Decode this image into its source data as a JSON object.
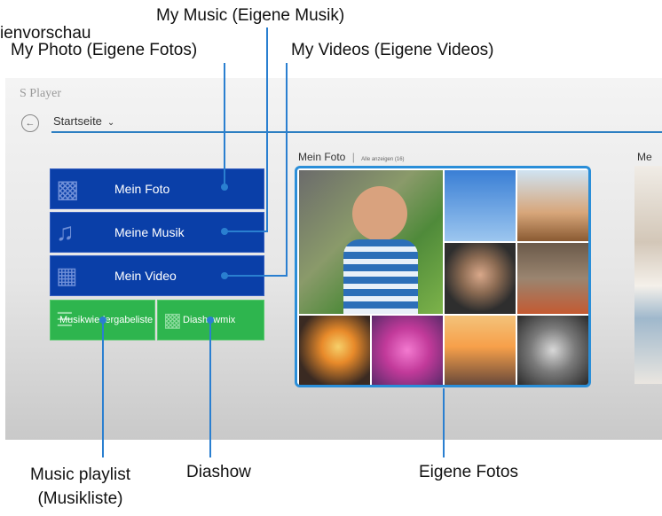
{
  "callouts": {
    "preview": "ienvorschau",
    "music": "My Music (Eigene Musik)",
    "photo": "My Photo (Eigene Fotos)",
    "videos": "My Videos (Eigene Videos)",
    "playlist_line1": "Music playlist",
    "playlist_line2": "(Musikliste)",
    "slideshow": "Diashow",
    "own_photos": "Eigene Fotos"
  },
  "app": {
    "title": "S Player",
    "breadcrumb": "Startseite",
    "back_icon": "back-arrow-icon"
  },
  "tiles": {
    "photo": "Mein Foto",
    "music": "Meine Musik",
    "video": "Mein Video",
    "playlist": "Musikwiedergabeliste",
    "slideshow": "Diashowmix"
  },
  "photo_section": {
    "title": "Mein Foto",
    "show_all": "Alle anzeigen (16)"
  },
  "side_section": {
    "title": "Me"
  },
  "colors": {
    "accent": "#2a7fd0",
    "tile_blue": "#0a3fa8",
    "tile_green": "#2eb54e"
  }
}
